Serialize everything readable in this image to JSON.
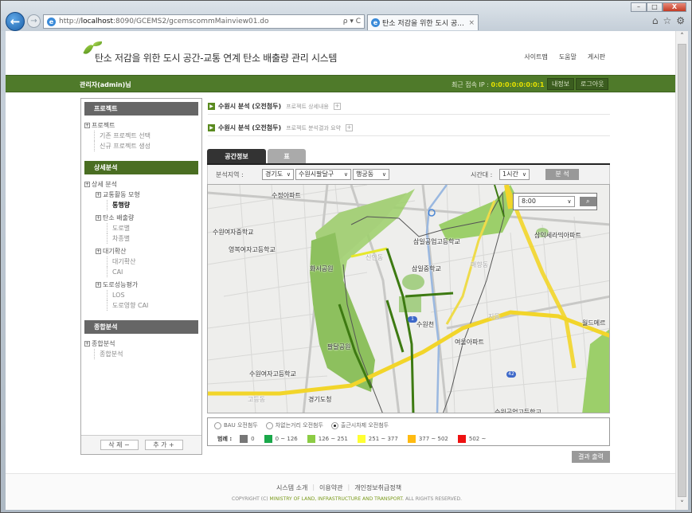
{
  "browser": {
    "url_prefix": "http://",
    "url_host": "localhost",
    "url_rest": ":8090/GCEMS2/gcemscommMainview01.do",
    "addr_tools": "ρ ▾ C",
    "tab_title": "탄소 저감을 위한 도시 공...",
    "tab_close": "×",
    "win_min": "–",
    "win_max": "□",
    "win_close": "X",
    "back": "←",
    "forward": "→",
    "home_icon": "⌂",
    "star_icon": "☆",
    "gear_icon": "⚙",
    "ie_glyph": "e"
  },
  "header": {
    "site_title": "탄소 저감을 위한 도시 공간-교통 연계 탄소 배출량 관리 시스템",
    "top_links": [
      "사이트맵",
      "도움말",
      "게시판"
    ],
    "user_label": "관리자(admin)님",
    "ip_label": "최근 접속 IP : ",
    "ip_value": "0:0:0:0:0:0:0:1",
    "my_info_button": "내정보",
    "logout_button": "로그아웃"
  },
  "sidebar": {
    "sections": [
      {
        "title": "프로젝트",
        "root": "프로젝트",
        "items": [
          "기존 프로젝트 선택",
          "신규 프로젝트 생성"
        ]
      },
      {
        "title": "상세분석",
        "root": "상세 분석",
        "groups": [
          {
            "label": "교통활동 모형",
            "items": [
              "통행량"
            ]
          },
          {
            "label": "탄소 배출량",
            "items": [
              "도로별",
              "차종별"
            ]
          },
          {
            "label": "대기확산",
            "items": [
              "대기확산",
              "CAI"
            ]
          },
          {
            "label": "도로성능평가",
            "items": [
              "LOS",
              "도로영향 CAI"
            ]
          }
        ]
      },
      {
        "title": "종합분석",
        "root": "종합분석",
        "items": [
          "종합분석"
        ]
      }
    ],
    "delete_button": "삭 제  −",
    "add_button": "추 가  +",
    "plus_glyph": "+"
  },
  "projects": [
    {
      "title": "수원시 분석 (오전첨두)",
      "subtitle": "프로젝트 상세내용",
      "toggle": "+"
    },
    {
      "title": "수원시 분석 (오전첨두)",
      "subtitle": "프로젝트 분석결과 요약",
      "toggle": "+"
    }
  ],
  "tabs": [
    {
      "label": "공간정보",
      "active": true
    },
    {
      "label": "표",
      "active": false
    }
  ],
  "filter": {
    "region_label": "분석지역 :",
    "province": "경기도",
    "district": "수원시팔달구",
    "dong": "행궁동",
    "time_label": "시간대 :",
    "time_unit": "1시간",
    "analyze_button": "분 석",
    "chevron": "∨"
  },
  "map": {
    "time_value": "8:00",
    "search_icon": "🔍",
    "route_shield_1": "1",
    "route_shield_42": "42",
    "labels": [
      "수정아파트",
      "수원여자중학교",
      "영복여자고등학교",
      "화서공원",
      "신안동",
      "삼일공업고등학교",
      "삼일중학교",
      "매향동",
      "삼익세라믹아파트",
      "수원천",
      "지동",
      "월드메르",
      "여울아파트",
      "팔달공원",
      "수원여자고등학교",
      "경기도청",
      "고등동",
      "수원공업고등학교"
    ]
  },
  "legend": {
    "options": [
      {
        "label": "BAU 오전첨두",
        "selected": false
      },
      {
        "label": "차없는거리 오전첨두",
        "selected": false
      },
      {
        "label": "출근시차제 오전첨두",
        "selected": true
      }
    ],
    "title": "범례 :",
    "items": [
      {
        "label": "0",
        "color": "#777777"
      },
      {
        "label": "0 ~ 126",
        "color": "#1aa84a"
      },
      {
        "label": "126 ~ 251",
        "color": "#8ccc44"
      },
      {
        "label": "251 ~ 377",
        "color": "#ffff33"
      },
      {
        "label": "377 ~ 502",
        "color": "#ffbb11"
      },
      {
        "label": "502 ~",
        "color": "#ee1111"
      }
    ]
  },
  "print_button": "결과 출력",
  "footer": {
    "links": [
      "시스템 소개",
      "이용약관",
      "개인정보취급정책"
    ],
    "sep": "|",
    "copyright_prefix": "COPYRIGHT (C)",
    "copyright_org": "MINISTRY OF LAND, INFRASTRUCTURE AND TRANSPORT.",
    "copyright_suffix": "ALL RIGHTS RESERVED."
  },
  "colors": {
    "brand_green": "#4f7a2a",
    "ip_yellow": "#e6e100"
  }
}
